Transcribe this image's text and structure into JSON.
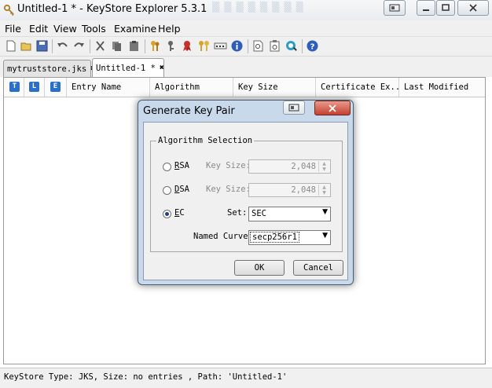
{
  "window": {
    "title": "Untitled-1 * - KeyStore Explorer 5.3.1",
    "accent": "#c8d9ec"
  },
  "menu": [
    "File",
    "Edit",
    "View",
    "Tools",
    "Examine",
    "Help"
  ],
  "toolbar_icons": [
    "new-icon",
    "open-icon",
    "save-icon",
    "undo-icon",
    "redo-icon",
    "cut-icon",
    "copy-icon",
    "paste-icon",
    "generate-key-pair-icon",
    "generate-secret-key-icon",
    "import-trusted-cert-icon",
    "import-key-pair-icon",
    "set-password-icon",
    "properties-icon",
    "examine-file-icon",
    "examine-clipboard-icon",
    "examine-ssl-icon",
    "help-icon"
  ],
  "tabs": [
    {
      "label": "mytruststore.jks",
      "active": false
    },
    {
      "label": "Untitled-1 *",
      "active": true
    }
  ],
  "table": {
    "columns": [
      "Entry Name",
      "Algorithm",
      "Key Size",
      "Certificate Ex...",
      "Last Modified"
    ],
    "icon_columns": [
      "T",
      "L",
      "E"
    ]
  },
  "status": "KeyStore Type: JKS, Size: no entries , Path: 'Untitled-1'",
  "dialog": {
    "title": "Generate Key Pair",
    "group_title": "Algorithm Selection",
    "rsa": {
      "label": "RSA",
      "underline": "R",
      "rest": "SA",
      "key_size_label": "Key Size:",
      "key_size": "2,048"
    },
    "dsa": {
      "label": "DSA",
      "underline": "D",
      "rest": "SA",
      "key_size_label": "Key Size:",
      "key_size": "2,048"
    },
    "ec": {
      "label": "EC",
      "underline": "E",
      "rest": "C",
      "set_label": "Set:",
      "set_value": "SEC",
      "curve_label": "Named Curve:",
      "curve_value": "secp256r1"
    },
    "selected": "EC",
    "ok": "OK",
    "cancel": "Cancel"
  }
}
